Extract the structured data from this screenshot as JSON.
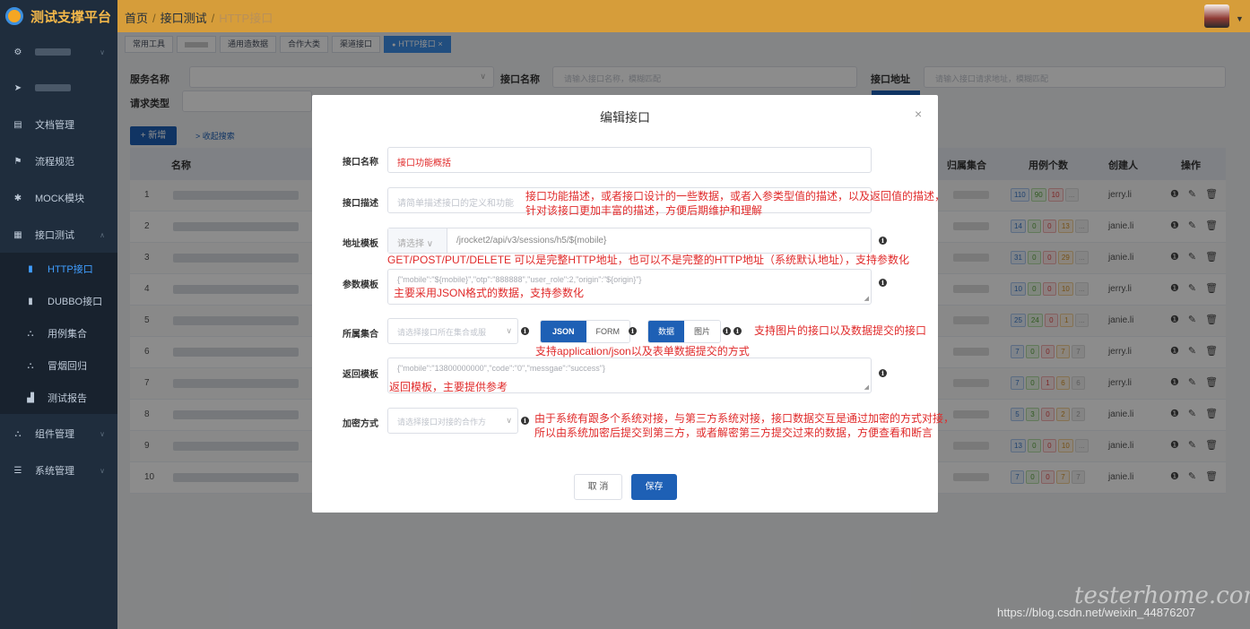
{
  "app": {
    "title": "测试支撑平台",
    "breadcrumb": [
      "首页",
      "接口测试"
    ],
    "breadcrumb_current": "HTTP接口"
  },
  "sidebar": {
    "items": [
      {
        "label": "",
        "icon": "gear-icon"
      },
      {
        "label": "",
        "icon": "send-icon"
      },
      {
        "label": "文档管理",
        "icon": "document-icon"
      },
      {
        "label": "流程规范",
        "icon": "flag-icon"
      },
      {
        "label": "MOCK模块",
        "icon": "mock-icon"
      },
      {
        "label": "接口测试",
        "icon": "grid-icon"
      },
      {
        "label": "HTTP接口",
        "icon": "http-icon",
        "active": true
      },
      {
        "label": "DUBBO接口",
        "icon": "dubbo-icon"
      },
      {
        "label": "用例集合",
        "icon": "tree-icon"
      },
      {
        "label": "冒烟回归",
        "icon": "tree-icon"
      },
      {
        "label": "测试报告",
        "icon": "bar-chart-icon"
      },
      {
        "label": "组件管理",
        "icon": "tree-icon"
      },
      {
        "label": "系统管理",
        "icon": "list-icon"
      }
    ]
  },
  "tabs": [
    {
      "label": "常用工具"
    },
    {
      "label": ""
    },
    {
      "label": "通用造数据"
    },
    {
      "label": "合作大类"
    },
    {
      "label": "渠道接口"
    },
    {
      "label": "HTTP接口",
      "active": true,
      "close": "×"
    }
  ],
  "filters": {
    "service_name_label": "服务名称",
    "interface_name_label": "接口名称",
    "interface_name_placeholder": "请输入接口名称，模糊匹配",
    "address_label": "接口地址",
    "address_placeholder": "请输入接口请求地址，模糊匹配",
    "request_type_label": "请求类型",
    "new_button": "+ 新增",
    "collapse_link": "> 收起搜索"
  },
  "table": {
    "headers": [
      "名称",
      "归属集合",
      "用例个数",
      "创建人",
      "操作"
    ],
    "rows": [
      {
        "no": "1",
        "counts": [
          "110",
          "90",
          "10",
          "..."
        ],
        "creator": "jerry.li"
      },
      {
        "no": "2",
        "counts": [
          "14",
          "0",
          "0",
          "13",
          "..."
        ],
        "creator": "janie.li"
      },
      {
        "no": "3",
        "counts": [
          "31",
          "0",
          "0",
          "29",
          "..."
        ],
        "creator": "janie.li"
      },
      {
        "no": "4",
        "counts": [
          "10",
          "0",
          "0",
          "10",
          "..."
        ],
        "creator": "jerry.li"
      },
      {
        "no": "5",
        "counts": [
          "25",
          "24",
          "0",
          "1",
          "..."
        ],
        "creator": "janie.li"
      },
      {
        "no": "6",
        "counts": [
          "7",
          "0",
          "0",
          "7",
          "7"
        ],
        "creator": "jerry.li"
      },
      {
        "no": "7",
        "counts": [
          "7",
          "0",
          "1",
          "6",
          "6"
        ],
        "creator": "jerry.li"
      },
      {
        "no": "8",
        "counts": [
          "5",
          "3",
          "0",
          "2",
          "2"
        ],
        "creator": "janie.li"
      },
      {
        "no": "9",
        "counts": [
          "13",
          "0",
          "0",
          "10",
          "..."
        ],
        "creator": "janie.li"
      },
      {
        "no": "10",
        "counts": [
          "7",
          "0",
          "0",
          "7",
          "7"
        ],
        "creator": "janie.li"
      }
    ]
  },
  "modal": {
    "title": "编辑接口",
    "close": "×",
    "name_label": "接口名称",
    "name_value": "接口功能概括",
    "desc_label": "接口描述",
    "desc_placeholder": "请简单描述接口的定义和功能",
    "addr_label": "地址模板",
    "addr_select": "请选择",
    "addr_value": "/jrocket2/api/v3/sessions/h5/${mobile}",
    "params_label": "参数模板",
    "params_value": "{\"mobile\":\"${mobile}\",\"otp\":\"888888\",\"user_role\":2,\"origin\":\"${origin}\"}",
    "collection_label": "所属集合",
    "collection_placeholder": "请选择接口所在集合或服",
    "format_json": "JSON",
    "format_form": "FORM",
    "type_data": "数据",
    "type_image": "图片",
    "return_label": "返回模板",
    "return_value": "{\"mobile\":\"13800000000\",\"code\":\"0\",\"messgae\":\"success\"}",
    "encrypt_label": "加密方式",
    "encrypt_placeholder": "请选择接口对接的合作方",
    "cancel": "取 消",
    "save": "保存"
  },
  "annotations": {
    "desc_line1": "接口功能描述，或者接口设计的一些数据，或者入参类型值的描述，以及返回值的描述，",
    "desc_line2": "针对该接口更加丰富的描述，方便后期维护和理解",
    "addr": "GET/POST/PUT/DELETE 可以是完整HTTP地址，也可以不是完整的HTTP地址（系统默认地址），支持参数化",
    "params": "主要采用JSON格式的数据，支持参数化",
    "image": "支持图片的接口以及数据提交的接口",
    "format": "支持application/json以及表单数据提交的方式",
    "return": "返回模板，主要提供参考",
    "encrypt_line1": "由于系统有跟多个系统对接，与第三方系统对接，接口数据交互是通过加密的方式对接，",
    "encrypt_line2": "所以由系统加密后提交到第三方，或者解密第三方提交过来的数据，方便查看和断言"
  },
  "watermark": {
    "brand": "testerhome.com",
    "url": "https://blog.csdn.net/weixin_44876207"
  },
  "colors": {
    "topbar": "#d69d3a",
    "sidebar": "#1f2d3d",
    "primary": "#1e60b5",
    "annotation": "#e02a2a"
  }
}
